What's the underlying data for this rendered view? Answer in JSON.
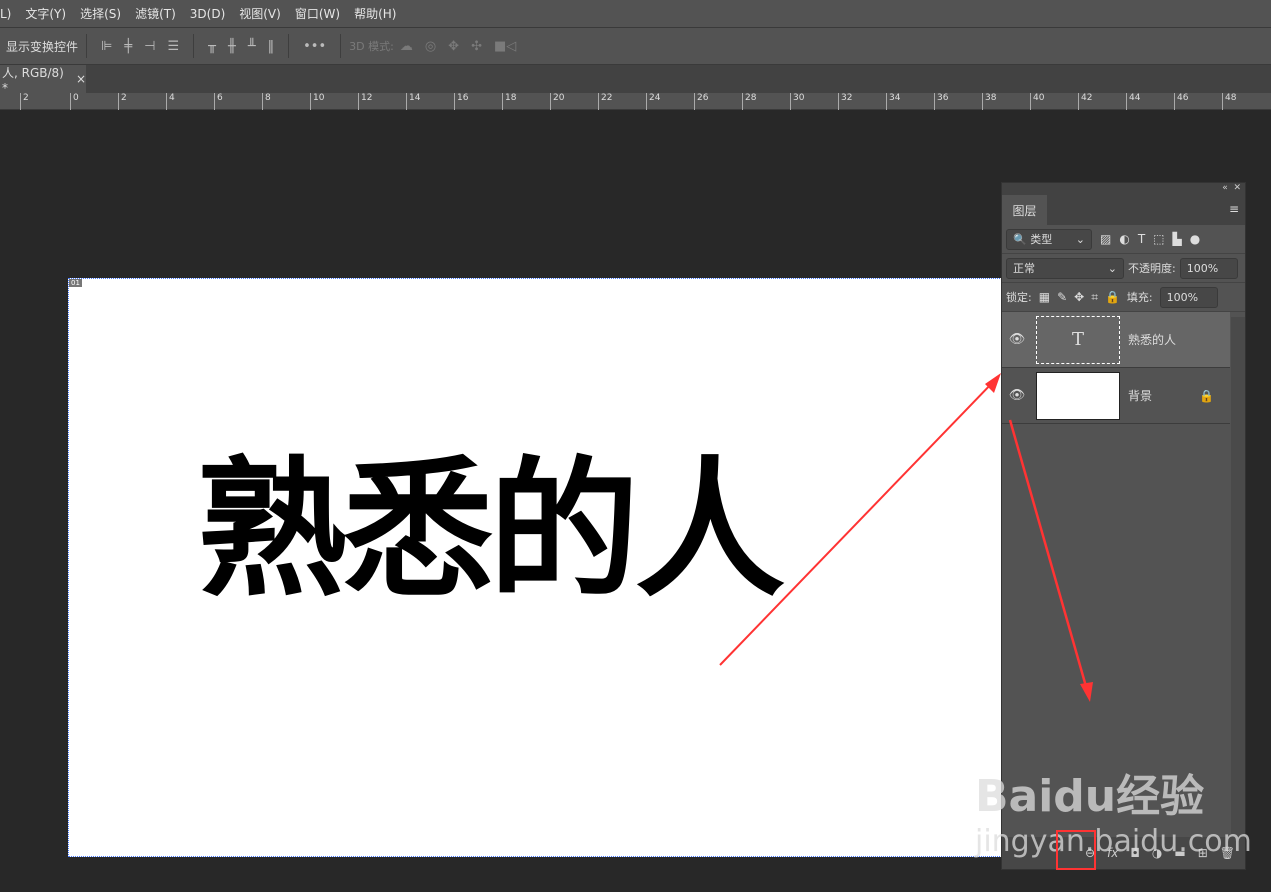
{
  "menu": [
    "L)",
    "文字(Y)",
    "选择(S)",
    "滤镜(T)",
    "3D(D)",
    "视图(V)",
    "窗口(W)",
    "帮助(H)"
  ],
  "options": {
    "show_transform": "显示变换控件",
    "more": "•••",
    "mode3d": "3D 模式:"
  },
  "tab": {
    "title": "人, RGB/8) *",
    "close": "×"
  },
  "ruler": [
    "2",
    "0",
    "2",
    "4",
    "6",
    "8",
    "10",
    "12",
    "14",
    "16",
    "18",
    "20",
    "22",
    "24",
    "26",
    "28",
    "30",
    "32",
    "34",
    "36",
    "38",
    "40",
    "42",
    "44",
    "46",
    "48"
  ],
  "canvas": {
    "text": "熟悉的人",
    "badge": "01"
  },
  "layers_panel": {
    "title": "图层",
    "filter": "类型",
    "blend": "正常",
    "opacity_label": "不透明度:",
    "opacity": "100%",
    "lock_label": "锁定:",
    "fill_label": "填充:",
    "fill": "100%",
    "layers": [
      {
        "name": "熟悉的人",
        "type": "text",
        "thumb": "T"
      },
      {
        "name": "背景",
        "type": "background",
        "locked": true
      }
    ],
    "bottom": {
      "fx": "fx"
    }
  },
  "watermark": {
    "brand": "Baidu经验",
    "url": "jingyan.baidu.com"
  },
  "annotation_color": "#ff3333"
}
